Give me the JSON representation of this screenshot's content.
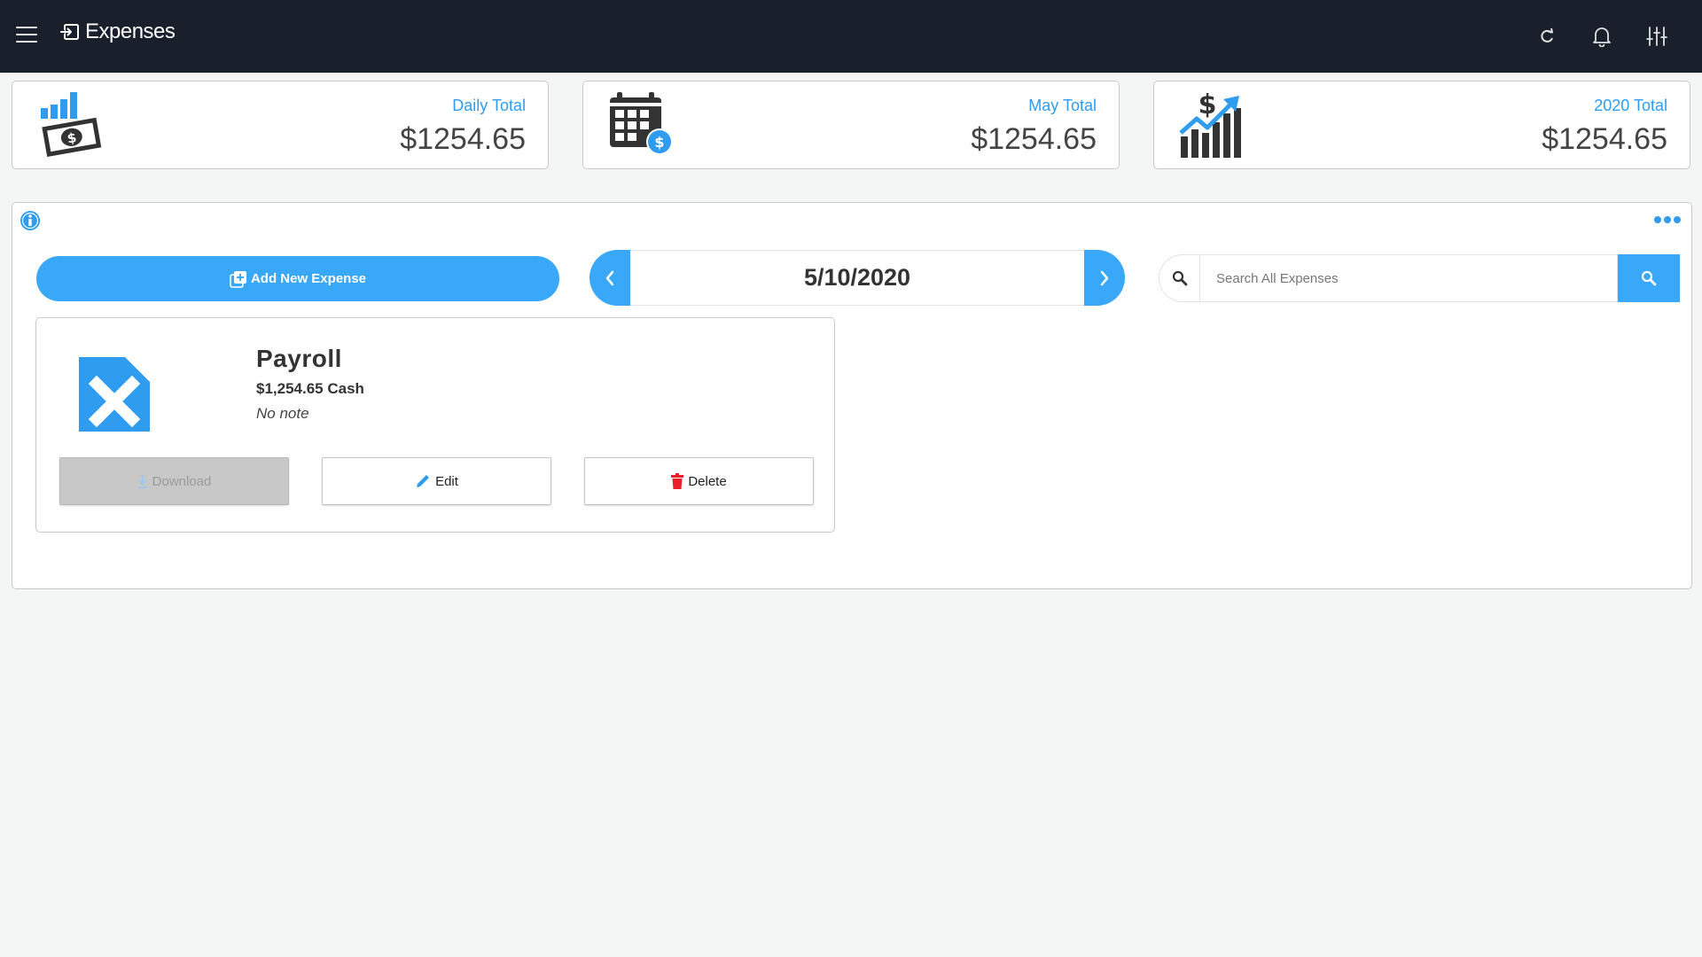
{
  "header": {
    "title": "Expenses",
    "icons": [
      "menu-icon",
      "app-exit-icon",
      "refresh-icon",
      "bell-icon",
      "sliders-icon"
    ]
  },
  "stats": [
    {
      "label": "Daily Total",
      "value": "$1254.65",
      "icon": "money-chart-icon"
    },
    {
      "label": "May Total",
      "value": "$1254.65",
      "icon": "calendar-dollar-icon"
    },
    {
      "label": "2020 Total",
      "value": "$1254.65",
      "icon": "dollar-growth-chart-icon"
    }
  ],
  "toolbar": {
    "add_label": "Add New Expense",
    "date": "5/10/2020",
    "search_placeholder": "Search All Expenses",
    "search_value": ""
  },
  "expense": {
    "title": "Payroll",
    "amount": "$1,254.65 Cash",
    "note": "No note",
    "download_label": "Download",
    "edit_label": "Edit",
    "delete_label": "Delete"
  },
  "colors": {
    "accent": "#3aa8f8",
    "topbar": "#19202b",
    "background": "#f4f6f5",
    "delete": "#e8202a",
    "disabled": "#c8c8c8"
  }
}
